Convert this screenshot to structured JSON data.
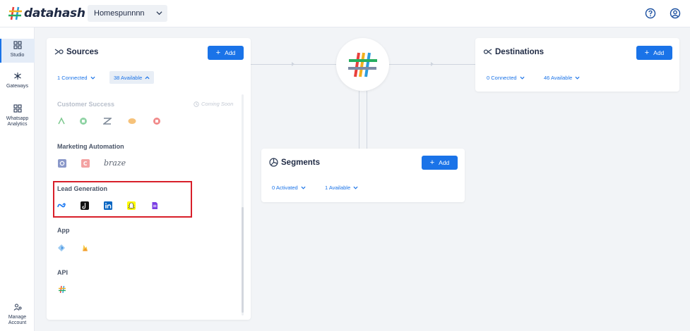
{
  "app": {
    "logo_text": "datahash",
    "workspace": "Homespunnnn"
  },
  "topbar": {
    "help_icon": "help-circle-icon",
    "account_icon": "user-circle-icon"
  },
  "sidebar": {
    "items": [
      {
        "label": "Studio",
        "icon": "grid-icon",
        "active": true
      },
      {
        "label": "Gateways",
        "icon": "hub-icon",
        "active": false
      },
      {
        "label": "Whatsapp Analytics",
        "icon": "grid-icon",
        "active": false
      },
      {
        "label": "Manage Account",
        "icon": "manage-users-icon",
        "active": false
      }
    ]
  },
  "sources": {
    "title": "Sources",
    "add_label": "Add",
    "connected_label": "1 Connected",
    "available_label": "38 Available",
    "coming_soon": "Coming Soon",
    "groups": [
      {
        "name": "Customer Success",
        "faded": true,
        "logos": [
          "gainsight-icon",
          "freshdesk-icon",
          "zendesk-icon",
          "intercom-icon",
          "freshchat-icon"
        ]
      },
      {
        "name": "Marketing Automation",
        "faded": false,
        "logos": [
          "hubspot-icon",
          "clevertap-icon",
          "braze-icon"
        ]
      },
      {
        "name": "Lead Generation",
        "faded": false,
        "logos": [
          "meta-icon",
          "tiktok-icon",
          "linkedin-icon",
          "snapchat-icon",
          "forms-icon"
        ]
      },
      {
        "name": "App",
        "faded": false,
        "logos": [
          "appsflyer-icon",
          "firebase-icon"
        ]
      },
      {
        "name": "API",
        "faded": false,
        "logos": [
          "datahash-api-icon"
        ]
      }
    ],
    "braze_text": "braze"
  },
  "segments": {
    "title": "Segments",
    "add_label": "Add",
    "activated_label": "0 Activated",
    "available_label": "1 Available"
  },
  "destinations": {
    "title": "Destinations",
    "add_label": "Add",
    "connected_label": "0 Connected",
    "available_label": "46 Available"
  },
  "colors": {
    "accent": "#1a73e8",
    "highlight": "#d81f2a"
  }
}
